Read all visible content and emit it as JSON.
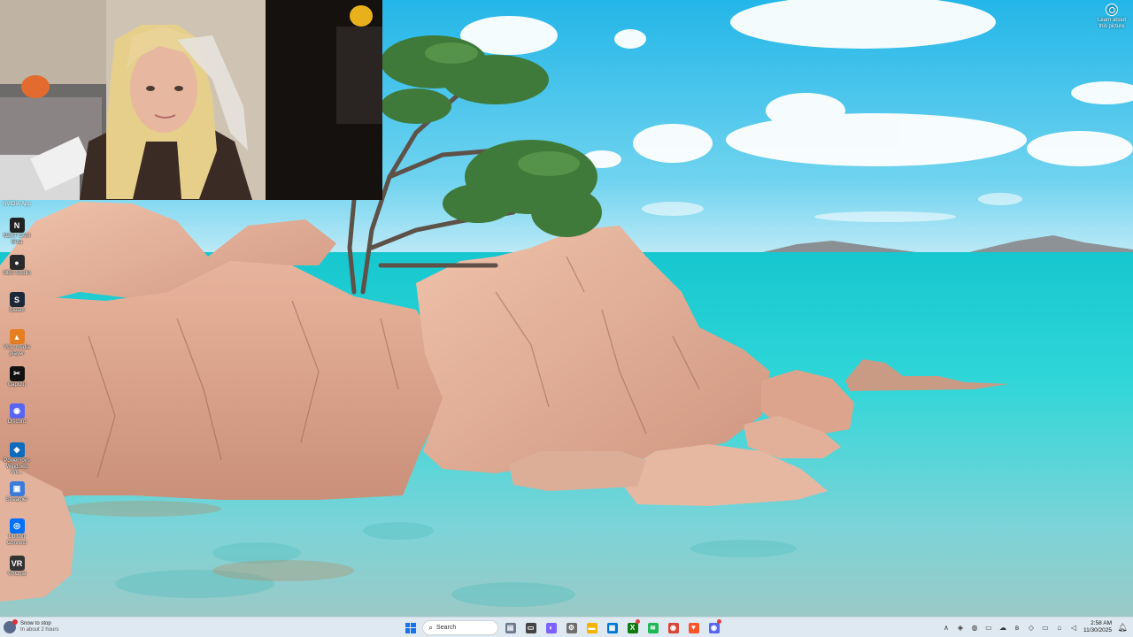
{
  "spotlight": {
    "label": "Learn about this picture",
    "icon": "camera-lens-icon"
  },
  "desktop": {
    "top_caption": "NVIDIA App",
    "icons": [
      {
        "label": "NZXT CAM Beta",
        "icon": "nzxt-icon",
        "color": "#222222",
        "glyph": "N"
      },
      {
        "label": "OBS Studio",
        "icon": "obs-icon",
        "color": "#2a2a2a",
        "glyph": "●"
      },
      {
        "label": "Steam",
        "icon": "steam-icon",
        "color": "#1b2838",
        "glyph": "S"
      },
      {
        "label": "VLC media player",
        "icon": "vlc-icon",
        "color": "#e67e22",
        "glyph": "▲"
      },
      {
        "label": "CapCut",
        "icon": "capcut-icon",
        "color": "#111111",
        "glyph": "✂"
      },
      {
        "label": "Discord",
        "icon": "discord-icon",
        "color": "#5865f2",
        "glyph": "◉"
      },
      {
        "label": "PowerToys Windows Wit...",
        "icon": "powertoys-icon",
        "color": "#0f6cbd",
        "glyph": "◆"
      },
      {
        "label": "Streamer",
        "icon": "streamer-icon",
        "color": "#3d7bd9",
        "glyph": "▣"
      },
      {
        "label": "Ubisoft Connect",
        "icon": "ubisoft-icon",
        "color": "#0070ff",
        "glyph": "◎"
      },
      {
        "label": "VRChat",
        "icon": "vrchat-icon",
        "color": "#333333",
        "glyph": "VR"
      }
    ]
  },
  "taskbar": {
    "left": {
      "line1": "Snow to stop",
      "line2": "In about 2 hours",
      "icon": "weather-icon"
    },
    "search_placeholder": "Search",
    "apps": [
      {
        "name": "widgets",
        "icon": "widgets-icon",
        "color": "#6b7a90",
        "glyph": "▤"
      },
      {
        "name": "task-view",
        "icon": "task-view-icon",
        "color": "#444444",
        "glyph": "▭"
      },
      {
        "name": "copilot",
        "icon": "copilot-icon",
        "color": "#7b61ff",
        "glyph": "◐"
      },
      {
        "name": "settings",
        "icon": "settings-icon",
        "color": "#6e6e6e",
        "glyph": "⚙"
      },
      {
        "name": "file-explorer",
        "icon": "folder-icon",
        "color": "#f5b400",
        "glyph": "▬"
      },
      {
        "name": "store",
        "icon": "store-icon",
        "color": "#0078d4",
        "glyph": "▦"
      },
      {
        "name": "xbox",
        "icon": "xbox-icon",
        "color": "#107c10",
        "glyph": "X"
      },
      {
        "name": "spotify",
        "icon": "spotify-icon",
        "color": "#1db954",
        "glyph": "≋"
      },
      {
        "name": "chrome",
        "icon": "chrome-icon",
        "color": "#db4437",
        "glyph": "◉"
      },
      {
        "name": "brave",
        "icon": "brave-icon",
        "color": "#fb542b",
        "glyph": "▼"
      },
      {
        "name": "discord",
        "icon": "discord-taskbar-icon",
        "color": "#5865f2",
        "glyph": "◉"
      }
    ],
    "tray": [
      {
        "name": "show-hidden",
        "icon": "chevron-up-icon",
        "glyph": "∧"
      },
      {
        "name": "tray-app-1",
        "icon": "shield-icon",
        "glyph": "◈"
      },
      {
        "name": "tray-app-2",
        "icon": "gamepad-icon",
        "glyph": "◍"
      },
      {
        "name": "tray-app-3",
        "icon": "chat-icon",
        "glyph": "▭"
      },
      {
        "name": "tray-app-4",
        "icon": "cloud-icon",
        "glyph": "☁"
      },
      {
        "name": "bluetooth",
        "icon": "bluetooth-icon",
        "glyph": "ʙ"
      },
      {
        "name": "security",
        "icon": "defender-icon",
        "glyph": "◇"
      },
      {
        "name": "display",
        "icon": "monitor-icon",
        "glyph": "▭"
      },
      {
        "name": "network",
        "icon": "network-icon",
        "glyph": "⌂"
      },
      {
        "name": "volume",
        "icon": "speaker-icon",
        "glyph": "◁"
      }
    ],
    "time": "2:58 AM",
    "date": "11/30/2025"
  }
}
